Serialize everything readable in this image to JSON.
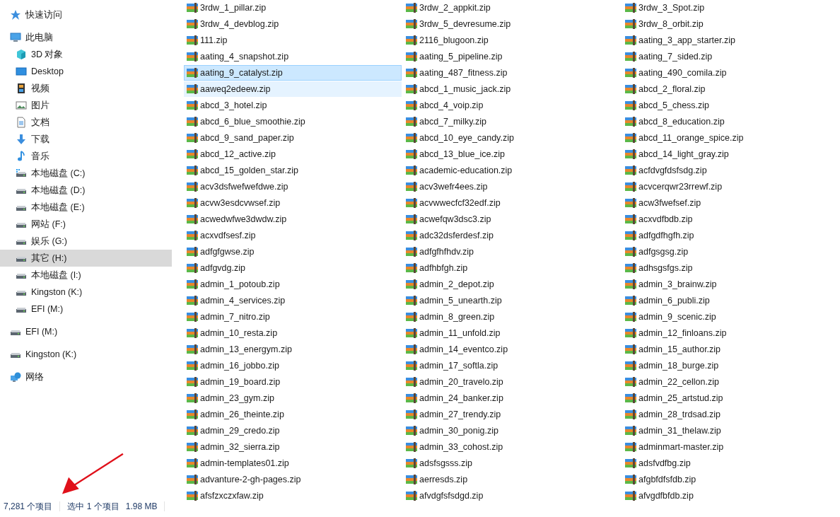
{
  "sidebar": {
    "items": [
      {
        "label": "快速访问",
        "kind": "star",
        "selected": false
      },
      {
        "label": "此电脑",
        "kind": "pc",
        "selected": false,
        "children": [
          {
            "label": "3D 对象",
            "kind": "cube",
            "selected": false
          },
          {
            "label": "Desktop",
            "kind": "desktop",
            "selected": false
          },
          {
            "label": "视频",
            "kind": "video",
            "selected": false
          },
          {
            "label": "图片",
            "kind": "picture",
            "selected": false
          },
          {
            "label": "文档",
            "kind": "document",
            "selected": false
          },
          {
            "label": "下载",
            "kind": "download",
            "selected": false
          },
          {
            "label": "音乐",
            "kind": "music",
            "selected": false
          },
          {
            "label": "本地磁盘 (C:)",
            "kind": "system-drive",
            "selected": false
          },
          {
            "label": "本地磁盘 (D:)",
            "kind": "drive",
            "selected": false
          },
          {
            "label": "本地磁盘 (E:)",
            "kind": "drive",
            "selected": false
          },
          {
            "label": "网站 (F:)",
            "kind": "drive",
            "selected": false
          },
          {
            "label": "娱乐 (G:)",
            "kind": "drive",
            "selected": false
          },
          {
            "label": "其它 (H:)",
            "kind": "drive",
            "selected": true
          },
          {
            "label": "本地磁盘 (I:)",
            "kind": "drive",
            "selected": false
          },
          {
            "label": "Kingston (K:)",
            "kind": "drive",
            "selected": false
          },
          {
            "label": "EFI (M:)",
            "kind": "drive",
            "selected": false
          }
        ]
      },
      {
        "label": "EFI (M:)",
        "kind": "drive",
        "selected": false
      },
      {
        "label": "Kingston (K:)",
        "kind": "drive",
        "selected": false
      },
      {
        "label": "网络",
        "kind": "network",
        "selected": false
      }
    ]
  },
  "files": [
    {
      "name": "3rdw_1_pillar.zip",
      "selected": false,
      "hovered": false
    },
    {
      "name": "3rdw_2_appkit.zip",
      "selected": false,
      "hovered": false
    },
    {
      "name": "3rdw_3_Spot.zip",
      "selected": false,
      "hovered": false
    },
    {
      "name": "3rdw_4_devblog.zip",
      "selected": false,
      "hovered": false
    },
    {
      "name": "3rdw_5_devresume.zip",
      "selected": false,
      "hovered": false
    },
    {
      "name": "3rdw_8_orbit.zip",
      "selected": false,
      "hovered": false
    },
    {
      "name": "111.zip",
      "selected": false,
      "hovered": false
    },
    {
      "name": "2116_blugoon.zip",
      "selected": false,
      "hovered": false
    },
    {
      "name": "aating_3_app_starter.zip",
      "selected": false,
      "hovered": false
    },
    {
      "name": "aating_4_snapshot.zip",
      "selected": false,
      "hovered": false
    },
    {
      "name": "aating_5_pipeline.zip",
      "selected": false,
      "hovered": false
    },
    {
      "name": "aating_7_sided.zip",
      "selected": false,
      "hovered": false
    },
    {
      "name": "aating_9_catalyst.zip",
      "selected": true,
      "hovered": false
    },
    {
      "name": "aating_487_fitness.zip",
      "selected": false,
      "hovered": false
    },
    {
      "name": "aating_490_comila.zip",
      "selected": false,
      "hovered": false
    },
    {
      "name": "aaweq2edeew.zip",
      "selected": false,
      "hovered": true
    },
    {
      "name": "abcd_1_music_jack.zip",
      "selected": false,
      "hovered": false
    },
    {
      "name": "abcd_2_floral.zip",
      "selected": false,
      "hovered": false
    },
    {
      "name": "abcd_3_hotel.zip",
      "selected": false,
      "hovered": false
    },
    {
      "name": "abcd_4_voip.zip",
      "selected": false,
      "hovered": false
    },
    {
      "name": "abcd_5_chess.zip",
      "selected": false,
      "hovered": false
    },
    {
      "name": "abcd_6_blue_smoothie.zip",
      "selected": false,
      "hovered": false
    },
    {
      "name": "abcd_7_milky.zip",
      "selected": false,
      "hovered": false
    },
    {
      "name": "abcd_8_education.zip",
      "selected": false,
      "hovered": false
    },
    {
      "name": "abcd_9_sand_paper.zip",
      "selected": false,
      "hovered": false
    },
    {
      "name": "abcd_10_eye_candy.zip",
      "selected": false,
      "hovered": false
    },
    {
      "name": "abcd_11_orange_spice.zip",
      "selected": false,
      "hovered": false
    },
    {
      "name": "abcd_12_active.zip",
      "selected": false,
      "hovered": false
    },
    {
      "name": "abcd_13_blue_ice.zip",
      "selected": false,
      "hovered": false
    },
    {
      "name": "abcd_14_light_gray.zip",
      "selected": false,
      "hovered": false
    },
    {
      "name": "abcd_15_golden_star.zip",
      "selected": false,
      "hovered": false
    },
    {
      "name": "academic-education.zip",
      "selected": false,
      "hovered": false
    },
    {
      "name": "acfdvgfdsfsdg.zip",
      "selected": false,
      "hovered": false
    },
    {
      "name": "acv3dsfwefwefdwe.zip",
      "selected": false,
      "hovered": false
    },
    {
      "name": "acv3wefr4ees.zip",
      "selected": false,
      "hovered": false
    },
    {
      "name": "acvcerqwr23rrewf.zip",
      "selected": false,
      "hovered": false
    },
    {
      "name": "acvw3esdcvwsef.zip",
      "selected": false,
      "hovered": false
    },
    {
      "name": "acvwwecfcf32edf.zip",
      "selected": false,
      "hovered": false
    },
    {
      "name": "acw3fwefsef.zip",
      "selected": false,
      "hovered": false
    },
    {
      "name": "acwedwfwe3dwdw.zip",
      "selected": false,
      "hovered": false
    },
    {
      "name": "acwefqw3dsc3.zip",
      "selected": false,
      "hovered": false
    },
    {
      "name": "acxvdfbdb.zip",
      "selected": false,
      "hovered": false
    },
    {
      "name": "acxvdfsesf.zip",
      "selected": false,
      "hovered": false
    },
    {
      "name": "adc32dsferdesf.zip",
      "selected": false,
      "hovered": false
    },
    {
      "name": "adfgdfhgfh.zip",
      "selected": false,
      "hovered": false
    },
    {
      "name": "adfgfgwse.zip",
      "selected": false,
      "hovered": false
    },
    {
      "name": "adfgfhfhdv.zip",
      "selected": false,
      "hovered": false
    },
    {
      "name": "adfgsgsg.zip",
      "selected": false,
      "hovered": false
    },
    {
      "name": "adfgvdg.zip",
      "selected": false,
      "hovered": false
    },
    {
      "name": "adfhbfgh.zip",
      "selected": false,
      "hovered": false
    },
    {
      "name": "adhsgsfgs.zip",
      "selected": false,
      "hovered": false
    },
    {
      "name": "admin_1_potoub.zip",
      "selected": false,
      "hovered": false
    },
    {
      "name": "admin_2_depot.zip",
      "selected": false,
      "hovered": false
    },
    {
      "name": "admin_3_brainw.zip",
      "selected": false,
      "hovered": false
    },
    {
      "name": "admin_4_services.zip",
      "selected": false,
      "hovered": false
    },
    {
      "name": "admin_5_unearth.zip",
      "selected": false,
      "hovered": false
    },
    {
      "name": "admin_6_publi.zip",
      "selected": false,
      "hovered": false
    },
    {
      "name": "admin_7_nitro.zip",
      "selected": false,
      "hovered": false
    },
    {
      "name": "admin_8_green.zip",
      "selected": false,
      "hovered": false
    },
    {
      "name": "admin_9_scenic.zip",
      "selected": false,
      "hovered": false
    },
    {
      "name": "admin_10_resta.zip",
      "selected": false,
      "hovered": false
    },
    {
      "name": "admin_11_unfold.zip",
      "selected": false,
      "hovered": false
    },
    {
      "name": "admin_12_finloans.zip",
      "selected": false,
      "hovered": false
    },
    {
      "name": "admin_13_energym.zip",
      "selected": false,
      "hovered": false
    },
    {
      "name": "admin_14_eventco.zip",
      "selected": false,
      "hovered": false
    },
    {
      "name": "admin_15_author.zip",
      "selected": false,
      "hovered": false
    },
    {
      "name": "admin_16_jobbo.zip",
      "selected": false,
      "hovered": false
    },
    {
      "name": "admin_17_softla.zip",
      "selected": false,
      "hovered": false
    },
    {
      "name": "admin_18_burge.zip",
      "selected": false,
      "hovered": false
    },
    {
      "name": "admin_19_board.zip",
      "selected": false,
      "hovered": false
    },
    {
      "name": "admin_20_travelo.zip",
      "selected": false,
      "hovered": false
    },
    {
      "name": "admin_22_cellon.zip",
      "selected": false,
      "hovered": false
    },
    {
      "name": "admin_23_gym.zip",
      "selected": false,
      "hovered": false
    },
    {
      "name": "admin_24_banker.zip",
      "selected": false,
      "hovered": false
    },
    {
      "name": "admin_25_artstud.zip",
      "selected": false,
      "hovered": false
    },
    {
      "name": "admin_26_theinte.zip",
      "selected": false,
      "hovered": false
    },
    {
      "name": "admin_27_trendy.zip",
      "selected": false,
      "hovered": false
    },
    {
      "name": "admin_28_trdsad.zip",
      "selected": false,
      "hovered": false
    },
    {
      "name": "admin_29_credo.zip",
      "selected": false,
      "hovered": false
    },
    {
      "name": "admin_30_ponig.zip",
      "selected": false,
      "hovered": false
    },
    {
      "name": "admin_31_thelaw.zip",
      "selected": false,
      "hovered": false
    },
    {
      "name": "admin_32_sierra.zip",
      "selected": false,
      "hovered": false
    },
    {
      "name": "admin_33_cohost.zip",
      "selected": false,
      "hovered": false
    },
    {
      "name": "adminmart-master.zip",
      "selected": false,
      "hovered": false
    },
    {
      "name": "admin-templates01.zip",
      "selected": false,
      "hovered": false
    },
    {
      "name": "adsfsgsss.zip",
      "selected": false,
      "hovered": false
    },
    {
      "name": "adsfvdfbg.zip",
      "selected": false,
      "hovered": false
    },
    {
      "name": "advanture-2-gh-pages.zip",
      "selected": false,
      "hovered": false
    },
    {
      "name": "aerresds.zip",
      "selected": false,
      "hovered": false
    },
    {
      "name": "afgbfdfsfdb.zip",
      "selected": false,
      "hovered": false
    },
    {
      "name": "afsfzxczxfaw.zip",
      "selected": false,
      "hovered": false
    },
    {
      "name": "afvdgfsfsdgd.zip",
      "selected": false,
      "hovered": false
    },
    {
      "name": "afvgdfbfdb.zip",
      "selected": false,
      "hovered": false
    }
  ],
  "status_bar": {
    "item_count": "7,281 个项目",
    "selection": "选中 1 个项目",
    "selection_size": "1.98 MB"
  }
}
